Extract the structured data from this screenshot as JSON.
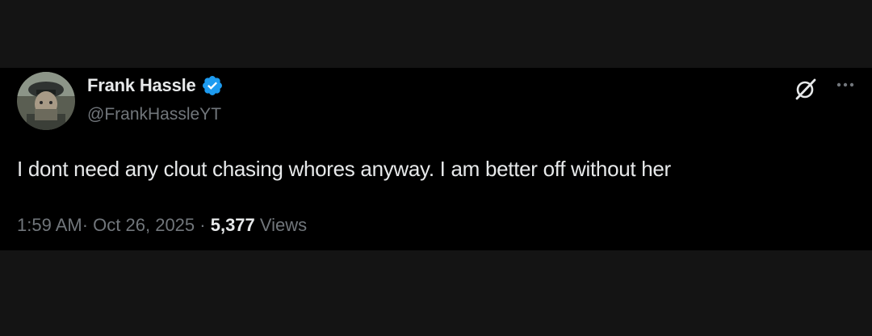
{
  "author": {
    "name": "Frank Hassle",
    "handle": "@FrankHassleYT"
  },
  "tweet": {
    "text": "I dont need any clout chasing whores anyway. I am better off without her"
  },
  "meta": {
    "time": "1:59 AM",
    "time_sep": "· ",
    "date": "Oct 26, 2025",
    "dot_sep": " · ",
    "views_count": "5,377",
    "views_label": " Views"
  },
  "icons": {
    "verified": "verified-badge-icon",
    "grok": "grok-icon",
    "more": "more-icon"
  },
  "colors": {
    "background": "#000000",
    "outer_background": "#141414",
    "primary_text": "#e7e9ea",
    "secondary_text": "#71767b",
    "verified_blue": "#1d9bf0"
  }
}
